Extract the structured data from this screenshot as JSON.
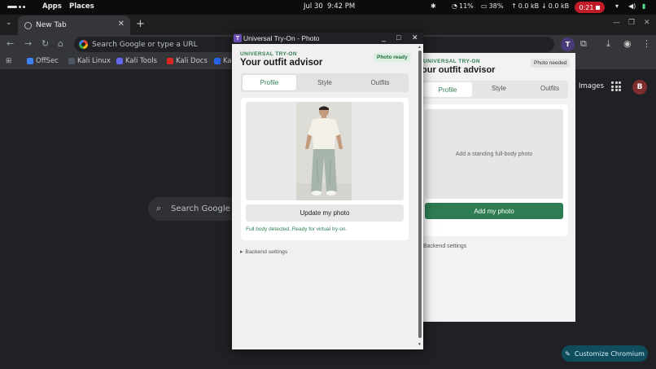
{
  "topbar": {
    "apps": "Apps",
    "places": "Places",
    "date": "Jul 30",
    "time": "9:42 PM",
    "cpu": "11%",
    "mem": "38%",
    "net_up": "0.0 kB",
    "net_down": "0.0 kB",
    "recording": "0:21"
  },
  "browser": {
    "tab_title": "New Tab",
    "omnibox_placeholder": "Search Google or type a URL",
    "extension_letter": "T",
    "bookmarks": [
      {
        "label": "OffSec",
        "color": "#3b82f6"
      },
      {
        "label": "Kali Linux",
        "color": "#1f2937"
      },
      {
        "label": "Kali Tools",
        "color": "#6366f1"
      },
      {
        "label": "Kali Docs",
        "color": "#dc2626"
      },
      {
        "label": "Ka",
        "color": "#2563eb"
      }
    ]
  },
  "ntp": {
    "search_placeholder": "Search Google o",
    "images": "Images",
    "avatar": "B",
    "customize": "Customize Chromium"
  },
  "bg_panel": {
    "brand": "UNIVERSAL TRY-ON",
    "title": "our outfit advisor",
    "badge": "Photo needed",
    "tabs": [
      "Profile",
      "Style",
      "Outfits"
    ],
    "photo_hint": "Add a standing full-body photo",
    "add_button": "Add my photo",
    "backend": "Backend settings"
  },
  "popup": {
    "window_title": "Universal Try-On - Photo",
    "icon_letter": "T",
    "brand": "UNIVERSAL TRY-ON",
    "title": "Your outfit advisor",
    "badge": "Photo ready",
    "tabs": [
      "Profile",
      "Style",
      "Outfits"
    ],
    "active_tab": "Profile",
    "update_button": "Update my photo",
    "status": "Full body detected. Ready for virtual try-on.",
    "backend": "Backend settings"
  },
  "colors": {
    "accent_green": "#2e7d52",
    "badge_ready_bg": "#dcefe2",
    "recording_red": "#c01c28"
  }
}
